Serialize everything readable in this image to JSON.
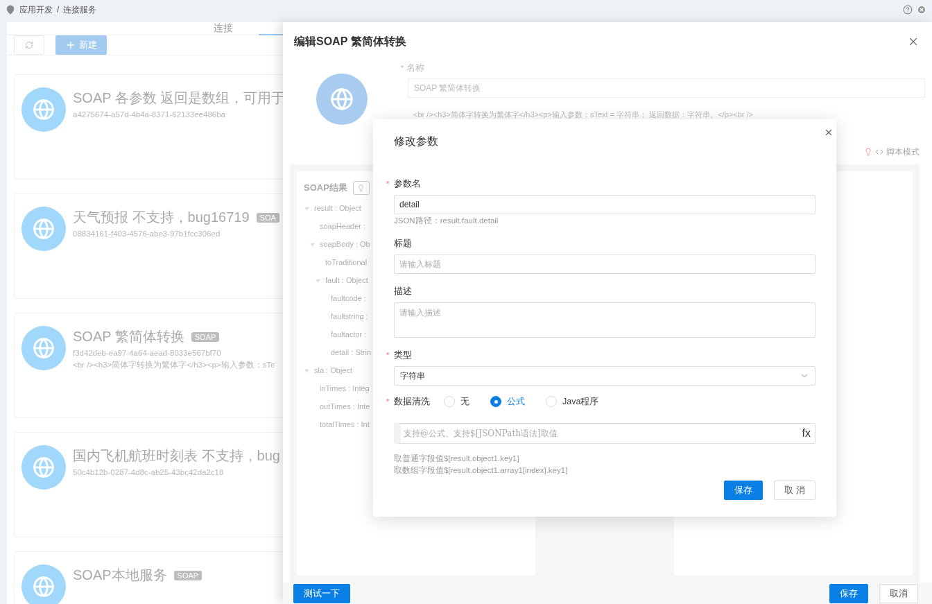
{
  "required_mark": "*",
  "breadcrumb": {
    "items": [
      "应用开发",
      "连接服务"
    ],
    "separator": "/"
  },
  "tabs": [
    {
      "label": "连接",
      "selected": false
    }
  ],
  "toolbar": {
    "new_button": "新建"
  },
  "services": [
    {
      "name": "SOAP 各参数 返回是数组，可用于",
      "id": "a4275674-a57d-4b4a-8371-62133ee486ba"
    },
    {
      "name": "天气预报 不支持，bug16719",
      "tag": "SOA",
      "id": "08834161-f403-4576-abe3-97b1fcc306ed"
    },
    {
      "name": "SOAP 繁简体转换",
      "tag": "SOAP",
      "id": "f3d42deb-ea97-4a64-aead-8033e567bf70",
      "description": "<br /><h3>简体字转换为繁体字</h3><p>输入参数：sTe"
    },
    {
      "name": "国内飞机航班时刻表 不支持，bug",
      "id": "50c4b12b-0287-4d8c-ab25-43bc42da2c18"
    },
    {
      "name": "SOAP本地服务",
      "tag": "SOAP"
    }
  ],
  "drawer": {
    "title": "编辑SOAP 繁简体转换",
    "name_label": "名称",
    "name_value": "SOAP 繁简体转换",
    "description": "<br /><h3>简体字转换为繁体字</h3><p>输入参数：sText = 字符串； 返回数据：字符串。</p><br />",
    "script_mode": "脚本模式",
    "tree": {
      "title": "SOAP结果",
      "nodes": [
        {
          "label": "result : Object",
          "expanded": true,
          "children": [
            {
              "label": "soapHeader :"
            },
            {
              "label": "soapBody : Ob",
              "expanded": true,
              "children": [
                {
                  "label": "toTraditional"
                },
                {
                  "label": "fault : Object",
                  "expanded": true,
                  "children": [
                    {
                      "label": "faultcode :"
                    },
                    {
                      "label": "faultstring :"
                    },
                    {
                      "label": "faultactor :"
                    },
                    {
                      "label": "detail : Strin"
                    }
                  ]
                }
              ]
            }
          ]
        },
        {
          "label": "sla : Object",
          "expanded": true,
          "children": [
            {
              "label": "inTimes : Integ"
            },
            {
              "label": "outTimes : Inte"
            },
            {
              "label": "totalTimes : Int"
            }
          ]
        }
      ]
    },
    "footer": {
      "test_button": "测试一下",
      "save_button": "保存",
      "cancel_button": "取消"
    }
  },
  "modal": {
    "title": "修改参数",
    "param_name": {
      "label": "参数名",
      "required": true,
      "value": "detail",
      "hint": "JSON路径：result.fault.detail"
    },
    "title_field": {
      "label": "标题",
      "required": false,
      "placeholder": "请输入标题"
    },
    "description_field": {
      "label": "描述",
      "required": false,
      "placeholder": "请输入描述"
    },
    "type_field": {
      "label": "类型",
      "required": true,
      "value": "字符串"
    },
    "cleaning": {
      "label": "数据清洗",
      "required": true,
      "options": [
        {
          "label": "无",
          "selected": false
        },
        {
          "label": "公式",
          "selected": true
        },
        {
          "label": "Java程序",
          "selected": false
        }
      ]
    },
    "formula": {
      "placeholder": "支持@公式、支持$[JSONPath语法]取值",
      "fx": "fx"
    },
    "hints": [
      "取普通字段值$[result.object1.key1]",
      "取数组字段值$[result.object1.array1[index].key1]"
    ],
    "save_button": "保存",
    "cancel_button": "取 消"
  }
}
